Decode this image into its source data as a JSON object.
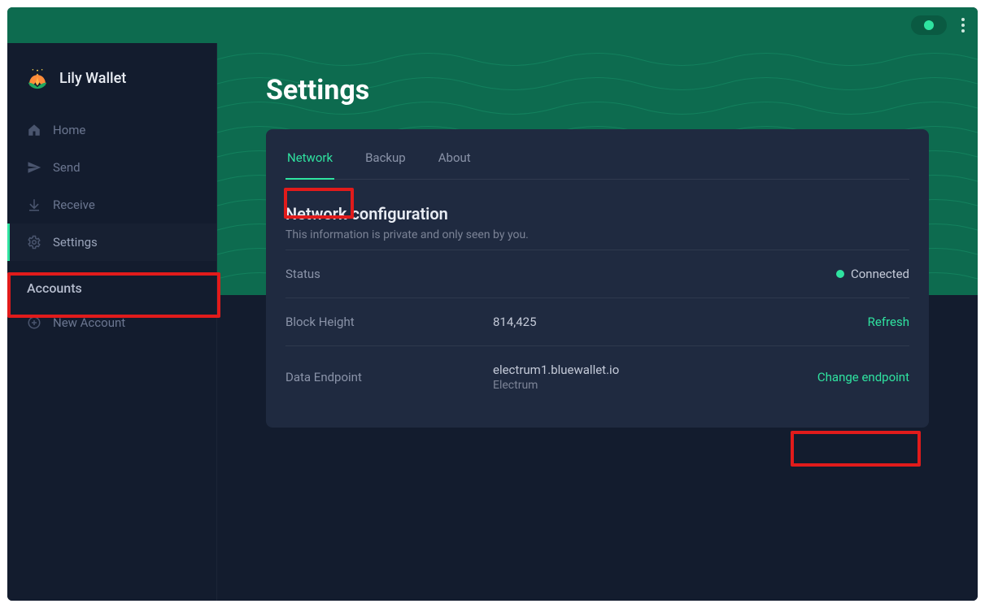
{
  "brand": {
    "name": "Lily Wallet"
  },
  "sidebar": {
    "items": [
      {
        "icon": "home-icon",
        "label": "Home"
      },
      {
        "icon": "send-icon",
        "label": "Send"
      },
      {
        "icon": "receive-icon",
        "label": "Receive"
      },
      {
        "icon": "gear-icon",
        "label": "Settings"
      }
    ],
    "accounts_label": "Accounts",
    "new_account_label": "New Account"
  },
  "page": {
    "title": "Settings"
  },
  "tabs": {
    "network": "Network",
    "backup": "Backup",
    "about": "About"
  },
  "panel": {
    "title": "Network configuration",
    "subtitle": "This information is private and only seen by you.",
    "status_label": "Status",
    "status_value": "Connected",
    "block_label": "Block Height",
    "block_value": "814,425",
    "refresh_label": "Refresh",
    "endpoint_label": "Data Endpoint",
    "endpoint_host": "electrum1.bluewallet.io",
    "endpoint_type": "Electrum",
    "change_endpoint_label": "Change endpoint"
  },
  "colors": {
    "accent": "#2fe3a0",
    "hero": "#0d6b4f",
    "card": "#1f2a40",
    "bg": "#131c2e"
  }
}
